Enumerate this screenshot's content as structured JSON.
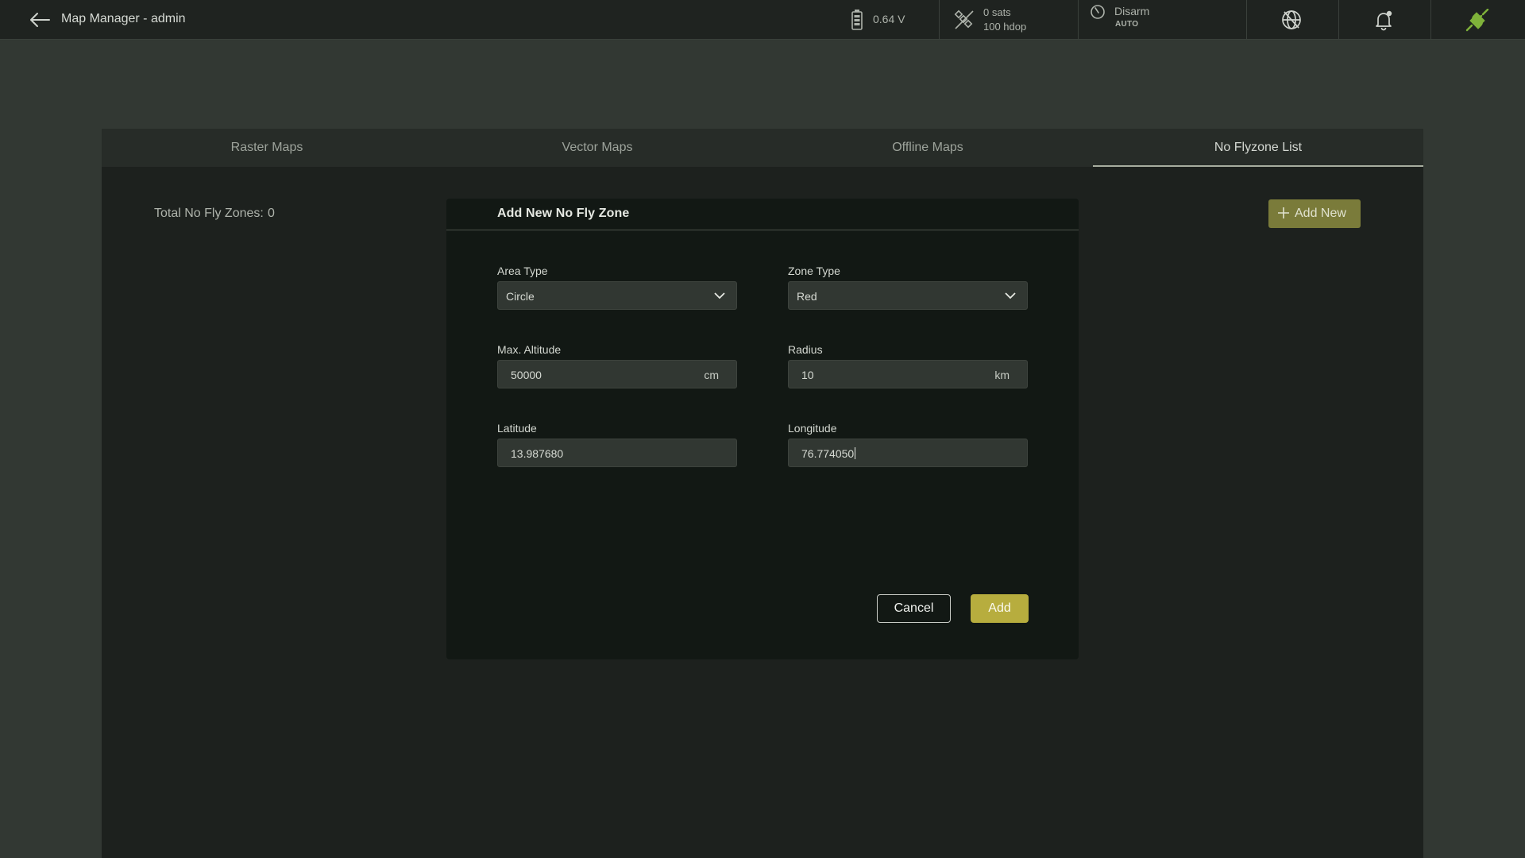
{
  "header": {
    "title": "Map Manager - admin",
    "battery": "0.64 V",
    "sats": "0 sats",
    "hdop": "100 hdop",
    "arm_state": "Disarm",
    "mode": "AUTO"
  },
  "tabs": [
    {
      "label": "Raster Maps",
      "active": false
    },
    {
      "label": "Vector Maps",
      "active": false
    },
    {
      "label": "Offline Maps",
      "active": false
    },
    {
      "label": "No Flyzone List",
      "active": true
    }
  ],
  "list": {
    "total_label": "Total No Fly Zones:",
    "total_value": "0",
    "add_new_label": "Add New"
  },
  "modal": {
    "title": "Add New No Fly Zone",
    "area_type": {
      "label": "Area Type",
      "value": "Circle"
    },
    "zone_type": {
      "label": "Zone Type",
      "value": "Red"
    },
    "max_altitude": {
      "label": "Max. Altitude",
      "value": "50000",
      "unit": "cm"
    },
    "radius": {
      "label": "Radius",
      "value": "10",
      "unit": "km"
    },
    "latitude": {
      "label": "Latitude",
      "value": "13.987680"
    },
    "longitude": {
      "label": "Longitude",
      "value": "76.774050"
    },
    "cancel_label": "Cancel",
    "add_label": "Add"
  },
  "colors": {
    "accent": "#b7ad3e",
    "connected_icon": "#7fb23a",
    "background": "#323833",
    "panel": "#1d211e",
    "modal": "#121814"
  }
}
